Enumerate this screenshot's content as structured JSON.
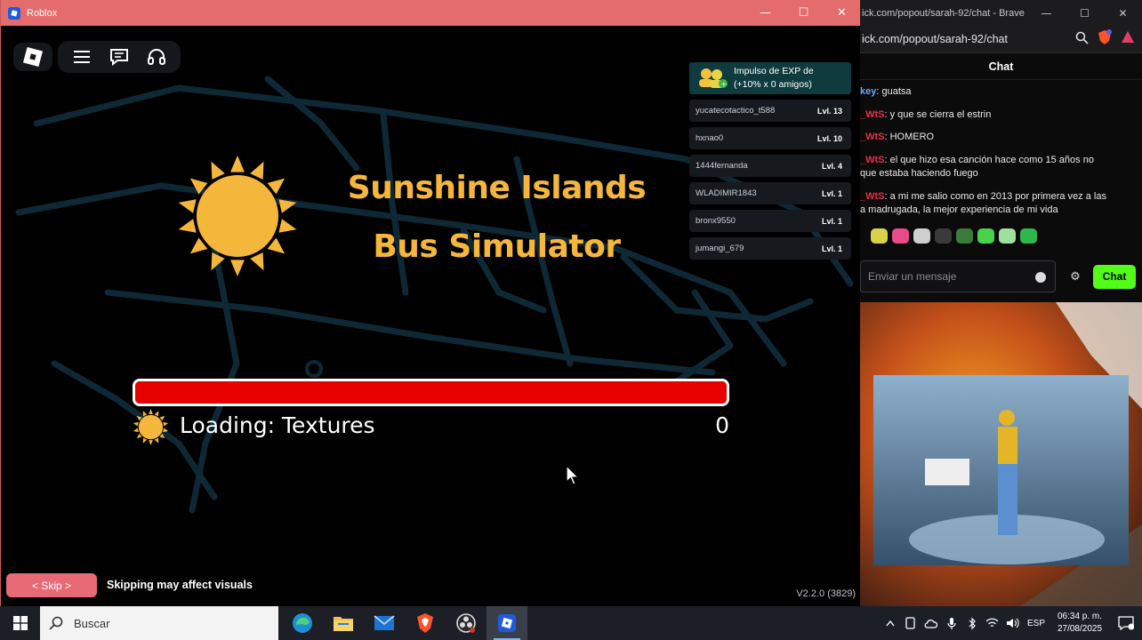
{
  "roblox_window": {
    "title": "Roblox",
    "controls": {
      "minimize": "—",
      "maximize": "☐",
      "close": "✕"
    },
    "game": {
      "title_line1": "Sunshine Islands",
      "title_line2": "Bus Simulator",
      "title_color": "#f5b63c",
      "top_buttons": [
        "roblox-logo-icon",
        "menu-icon",
        "chat-icon",
        "headset-icon"
      ],
      "exp_boost": {
        "label_line1": "Impulso de EXP de",
        "label_line2": "(+10% x 0 amigos)",
        "players": [
          {
            "name": "yucatecotactico_t588",
            "level": "Lvl. 13"
          },
          {
            "name": "hxnao0",
            "level": "Lvl. 10"
          },
          {
            "name": "1444fernanda",
            "level": "Lvl. 4"
          },
          {
            "name": "WLADIMIR1843",
            "level": "Lvl. 1"
          },
          {
            "name": "bronx9550",
            "level": "Lvl. 1"
          },
          {
            "name": "jumangi_679",
            "level": "Lvl. 1"
          }
        ]
      },
      "loading": {
        "label": "Loading: Textures",
        "count": "0",
        "progress": 1.0,
        "bar_color": "#e60000"
      },
      "skip_button": "< Skip >",
      "skip_note": "Skipping may affect visuals",
      "version": "V2.2.0 (3829)"
    }
  },
  "brave_window": {
    "title": "ick.com/popout/sarah-92/chat - Brave",
    "url": "ick.com/popout/sarah-92/chat",
    "chat_header": "Chat",
    "messages": [
      {
        "user": "key",
        "user_color": "#6aa8ff",
        "text": ": guatsa"
      },
      {
        "user": "_WtS",
        "user_color": "#e8304a",
        "text": ": y que se cierra el estrin"
      },
      {
        "user": "_WtS",
        "user_color": "#e8304a",
        "text": ": HOMERO"
      },
      {
        "user": "_WtS",
        "user_color": "#e8304a",
        "text": ": el que hizo esa canción hace como 15 años no",
        "text2": "que estaba haciendo fuego"
      },
      {
        "user": "_WtS",
        "user_color": "#e8304a",
        "text": ": a mi me salio como en 2013 por primera vez a las",
        "text2": "a madrugada, la mejor experiencia de mi vida"
      }
    ],
    "input_placeholder": "Enviar un mensaje",
    "send_label": "Chat",
    "accent": "#53fc18"
  },
  "taskbar": {
    "search_placeholder": "Buscar",
    "apps": [
      "edge-icon",
      "file-explorer-icon",
      "mail-icon",
      "brave-icon",
      "obs-icon",
      "roblox-icon"
    ],
    "language": "ESP",
    "time": "06:34 p. m.",
    "date": "27/08/2025"
  }
}
